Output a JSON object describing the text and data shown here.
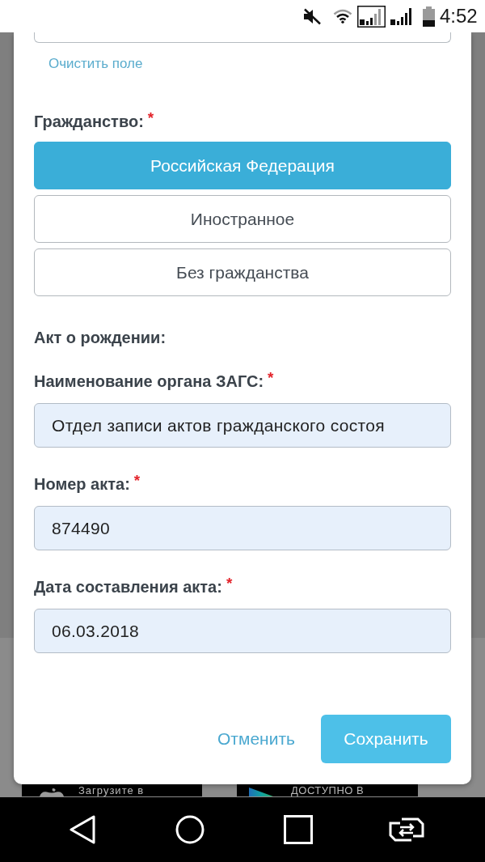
{
  "status_bar": {
    "time": "4:52"
  },
  "form": {
    "clear_link": "Очистить поле",
    "required_mark": "*",
    "citizenship": {
      "label": "Гражданство:",
      "required": true,
      "options": [
        {
          "label": "Российская Федерация",
          "selected": true
        },
        {
          "label": "Иностранное",
          "selected": false
        },
        {
          "label": "Без гражданства",
          "selected": false
        }
      ]
    },
    "section_title": "Акт о рождении:",
    "fields": [
      {
        "label": "Наименование органа ЗАГС:",
        "required": true,
        "value": "Отдел записи актов гражданского состоя"
      },
      {
        "label": "Номер акта:",
        "required": true,
        "value": "874490"
      },
      {
        "label": "Дата составления акта:",
        "required": true,
        "value": "06.03.2018"
      }
    ]
  },
  "actions": {
    "cancel": "Отменить",
    "save": "Сохранить"
  },
  "background": {
    "store_badges": [
      {
        "kind": "app_store",
        "text": "Загрузите в"
      },
      {
        "kind": "google_play",
        "text": "ДОСТУПНО В"
      }
    ]
  }
}
